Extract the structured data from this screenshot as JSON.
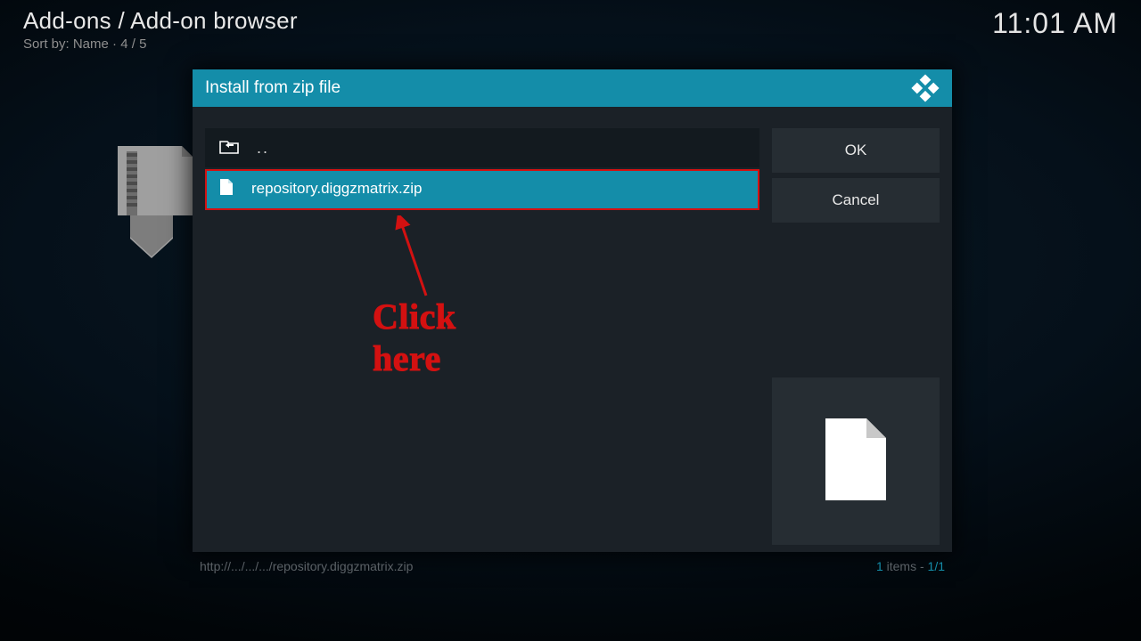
{
  "header": {
    "title": "Add-ons / Add-on browser",
    "sort_label": "Sort by: Name",
    "position": "4 / 5",
    "clock": "11:01 AM"
  },
  "dialog": {
    "title": "Install from zip file",
    "parent_label": "..",
    "items": [
      {
        "name": "repository.diggzmatrix.zip",
        "selected": true
      }
    ],
    "buttons": {
      "ok": "OK",
      "cancel": "Cancel"
    }
  },
  "footer": {
    "path": "http://.../.../.../repository.diggzmatrix.zip",
    "count_num": "1",
    "count_word": " items - ",
    "page": "1/1"
  },
  "annotation": {
    "text": "Click here"
  }
}
